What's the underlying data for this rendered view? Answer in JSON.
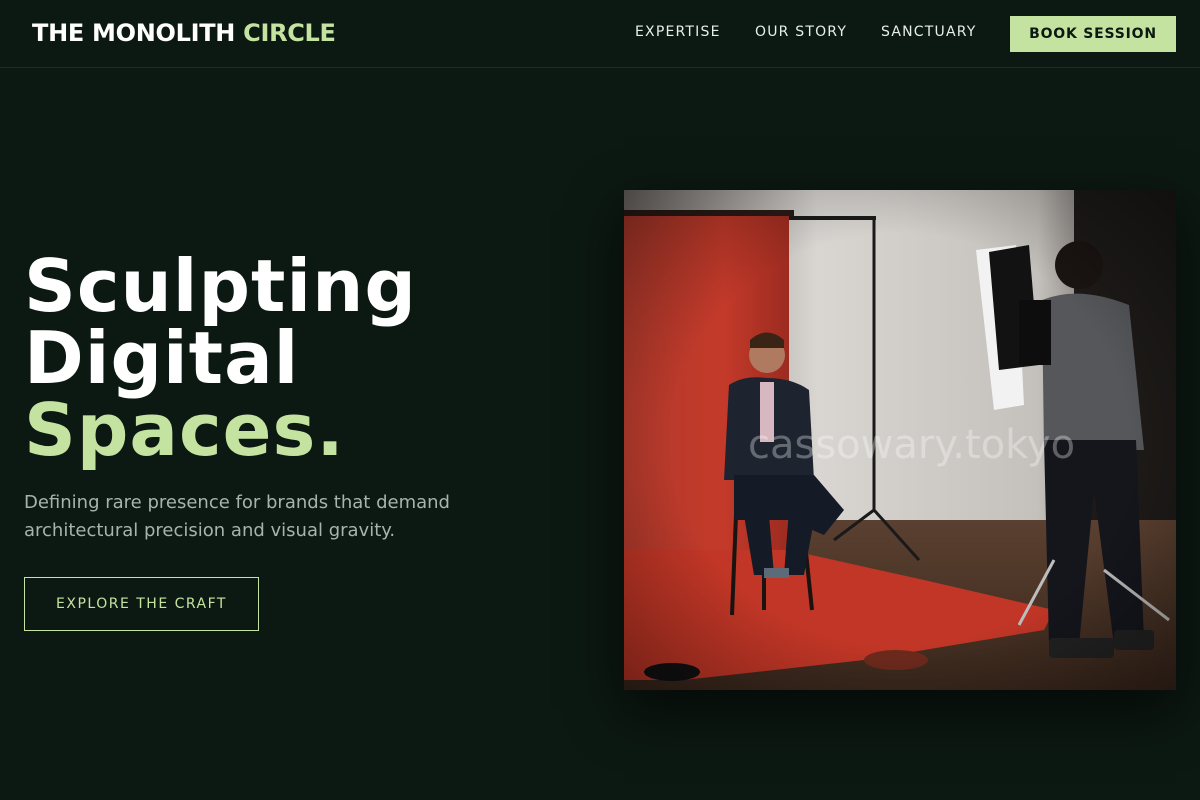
{
  "header": {
    "logo_main": "THE MONOLITH",
    "logo_accent": "CIRCLE",
    "nav": [
      {
        "label": "EXPERTISE"
      },
      {
        "label": "OUR STORY"
      },
      {
        "label": "SANCTUARY"
      }
    ],
    "cta_label": "BOOK SESSION"
  },
  "hero": {
    "title_line1": "Sculpting",
    "title_line2": "Digital",
    "title_line3": "Spaces.",
    "description": "Defining rare presence for brands that demand architectural precision and visual gravity.",
    "button_label": "EXPLORE THE CRAFT"
  },
  "photo": {
    "watermark": "cassowary.tokyo"
  },
  "colors": {
    "background": "#0c1812",
    "accent": "#c5e3a0",
    "text": "#ffffff",
    "muted": "#a9b3ad"
  }
}
